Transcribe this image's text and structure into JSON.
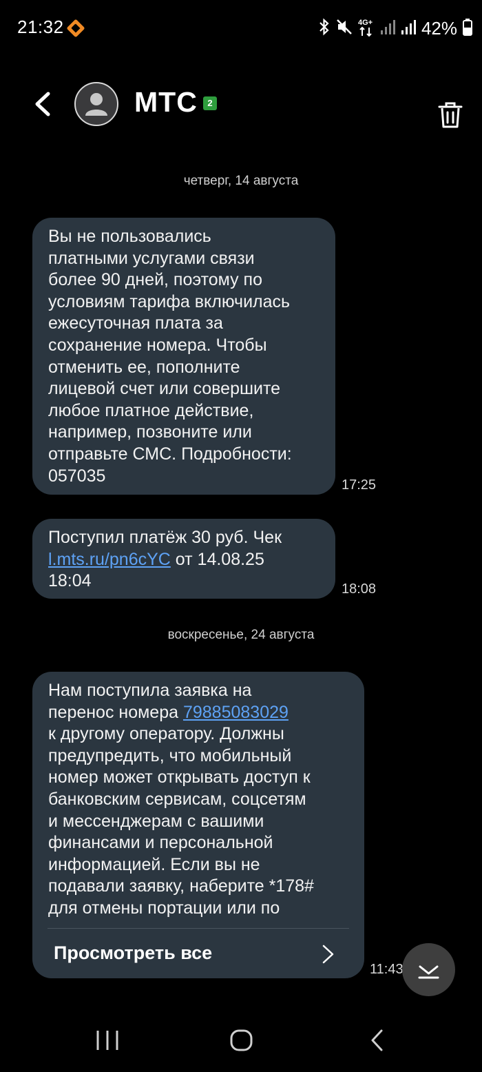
{
  "status_bar": {
    "time": "21:32",
    "battery_percent": "42%",
    "network_label": "4G+",
    "icons": [
      "bluetooth-icon",
      "mute-icon",
      "network-4g-icon",
      "signal-icon",
      "signal-icon",
      "battery-icon"
    ]
  },
  "header": {
    "contact_name": "МТС",
    "sim_badge": "2",
    "icons": [
      "back-arrow-icon",
      "avatar-person-icon",
      "trash-icon"
    ]
  },
  "conversation": {
    "date_separators": [
      "четверг, 14 августа",
      "воскресенье, 24 августа"
    ],
    "messages": [
      {
        "text": "Вы не пользовались\nплатными услугами связи\nболее 90 дней, поэтому по\nусловиям тарифа включилась\nежесуточная плата за\nсохранение номера. Чтобы\nотменить ее, пополните\nлицевой счет или совершите\nлюбое платное действие,\nнапример, позвоните или\nотправьте СМС. Подробности:\n057035",
        "time": "17:25"
      },
      {
        "text_before": "Поступил платёж 30 руб. Чек",
        "link": "l.mts.ru/pn6cYC",
        "text_after": " от 14.08.25\n18:04",
        "time": "18:08"
      },
      {
        "text_before": "Нам поступила заявка на\nперенос номера ",
        "link": "79885083029",
        "text_after": "\nк другому оператору. Должны\nпредупредить, что мобильный\nномер может открывать доступ к\nбанковским сервисам, соцсетям\nи мессенджерам с вашими\nфинансами и персональной\nинформацией. Если вы не\nподавали заявку, наберите *178#\nдля отмены портации или по",
        "view_all_label": "Просмотреть все",
        "time": "11:43"
      }
    ]
  },
  "navbar": {
    "icons": [
      "recent-apps-icon",
      "home-icon",
      "back-icon"
    ]
  },
  "colors": {
    "background": "#000000",
    "bubble": "#2b3640",
    "link": "#5ea2f5",
    "sim_badge": "#2e9d3d"
  }
}
